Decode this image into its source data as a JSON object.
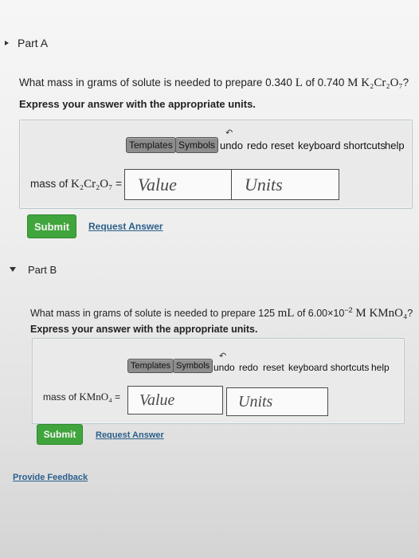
{
  "part_a": {
    "title": "Part A",
    "question_pre": "What mass in grams of solute is needed to prepare 0.340 ",
    "volume_unit": "L",
    "question_mid": " of 0.740 ",
    "molar_unit": "M",
    "formula": "K₂Cr₂O₇",
    "question_end": "?",
    "instruction": "Express your answer with the appropriate units.",
    "toolbar": {
      "templates": "Templates",
      "symbols": "Symbols",
      "undo": "undo",
      "redo": "redo",
      "reset": "reset",
      "shortcuts": "keyboard shortcuts",
      "help": "help"
    },
    "answer_label_pre": "mass of ",
    "answer_label_formula": "K₂Cr₂O₇",
    "answer_label_eq": " =",
    "value_placeholder": "Value",
    "units_placeholder": "Units",
    "submit": "Submit",
    "request_answer": "Request Answer"
  },
  "part_b": {
    "title": "Part B",
    "question_pre": "What mass in grams of solute is needed to prepare 125 ",
    "volume_unit": "mL",
    "question_mid": " of 6.00×10",
    "exponent": "−2",
    "molar_unit": " M ",
    "formula": "KMnO₄",
    "question_end": "?",
    "instruction": "Express your answer with the appropriate units.",
    "toolbar": {
      "templates": "Templates",
      "symbols": "Symbols",
      "undo": "undo",
      "redo": "redo",
      "reset": "reset",
      "shortcuts": "keyboard shortcuts",
      "help": "help"
    },
    "answer_label_pre": "mass of ",
    "answer_label_formula": "KMnO₄",
    "answer_label_eq": " =",
    "value_placeholder": "Value",
    "units_placeholder": "Units",
    "submit": "Submit",
    "request_answer": "Request Answer"
  },
  "feedback": "Provide Feedback",
  "colors": {
    "accent": "#2aa7b9",
    "submit": "#40a53c",
    "link": "#2a5f8a"
  }
}
